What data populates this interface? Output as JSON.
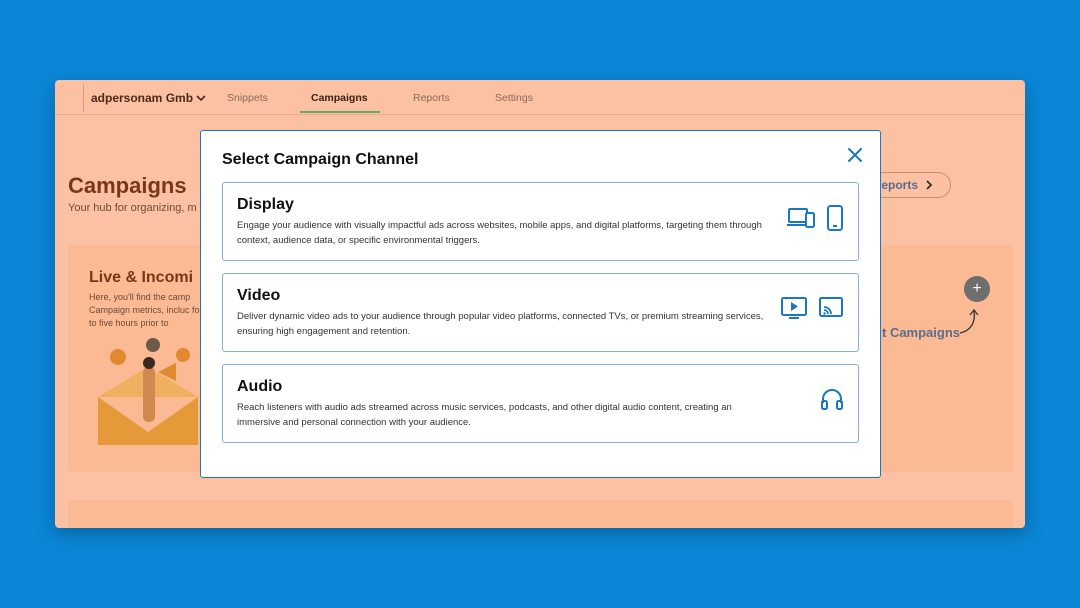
{
  "app": {
    "org_name": "adpersonam Gmb",
    "nav": [
      {
        "label": "Snippets"
      },
      {
        "label": "Campaigns",
        "active": true
      },
      {
        "label": "Reports"
      },
      {
        "label": "Settings"
      }
    ],
    "page_title": "Campaigns",
    "page_subtitle": "Your hub for organizing, m",
    "reports_button": "reports",
    "live_card": {
      "title": "Live & Incomi",
      "description": "Here, you'll find the camp Campaign metrics, incluc four to five hours prior to"
    },
    "add_hint": "t Campaigns",
    "bottom_card_title": ""
  },
  "modal": {
    "title": "Select Campaign Channel",
    "channels": [
      {
        "name": "Display",
        "description": "Engage your audience with visually impactful ads across websites, mobile apps, and digital platforms, targeting them through context, audience data, or specific environmental triggers.",
        "icons": [
          "devices-icon",
          "smartphone-icon"
        ]
      },
      {
        "name": "Video",
        "description": "Deliver dynamic video ads to your audience through popular video platforms, connected TVs, or premium streaming services, ensuring high engagement and retention.",
        "icons": [
          "video-play-icon",
          "cast-tv-icon"
        ]
      },
      {
        "name": "Audio",
        "description": "Reach listeners with audio ads streamed across music services, podcasts, and other digital audio content, creating an immersive and personal connection with your audience.",
        "icons": [
          "headphones-icon"
        ]
      }
    ]
  },
  "colors": {
    "backdrop": "#0b86d6",
    "overlay": "#fcc1a2",
    "accent": "#1a78c2",
    "title": "#111111"
  }
}
